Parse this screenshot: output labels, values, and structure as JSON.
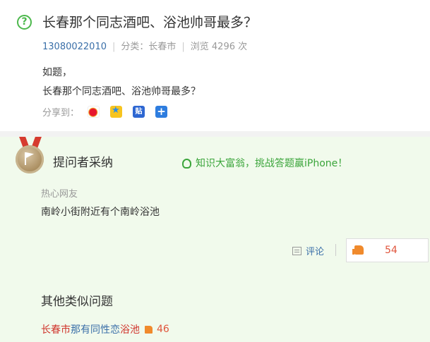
{
  "question": {
    "icon": "question-circle-icon",
    "title": "长春那个同志酒吧、浴池帅哥最多？",
    "user_id": "13080022010",
    "category": "分类：长春市",
    "views": "浏览 4296 次",
    "body_line1": "如题，",
    "body_line2": "长春那个同志酒吧、浴池帅哥最多？"
  },
  "share": {
    "label": "分享到：",
    "icons": [
      "weibo-icon",
      "qzone-icon",
      "tieba-icon",
      "more-icon"
    ],
    "tieba_glyph": "贴",
    "more_glyph": "+"
  },
  "answer": {
    "section_title": "提问者采纳",
    "promo": "知识大富翁，挑战答题赢iPhone！",
    "user": "热心网友",
    "text": "南岭小街附近有个南岭浴池",
    "comment_label": "评论",
    "likes": "54"
  },
  "similar": {
    "title": "其他类似问题",
    "item": {
      "part1": "长春市",
      "part2": "那有同性恋",
      "part3": "浴池",
      "likes": "46"
    }
  },
  "colors": {
    "accent_green": "#4cb84c",
    "link_blue": "#3a6fa8",
    "highlight_red": "#d0342c",
    "like_orange": "#f08a2c",
    "answer_bg": "#f1faec"
  }
}
